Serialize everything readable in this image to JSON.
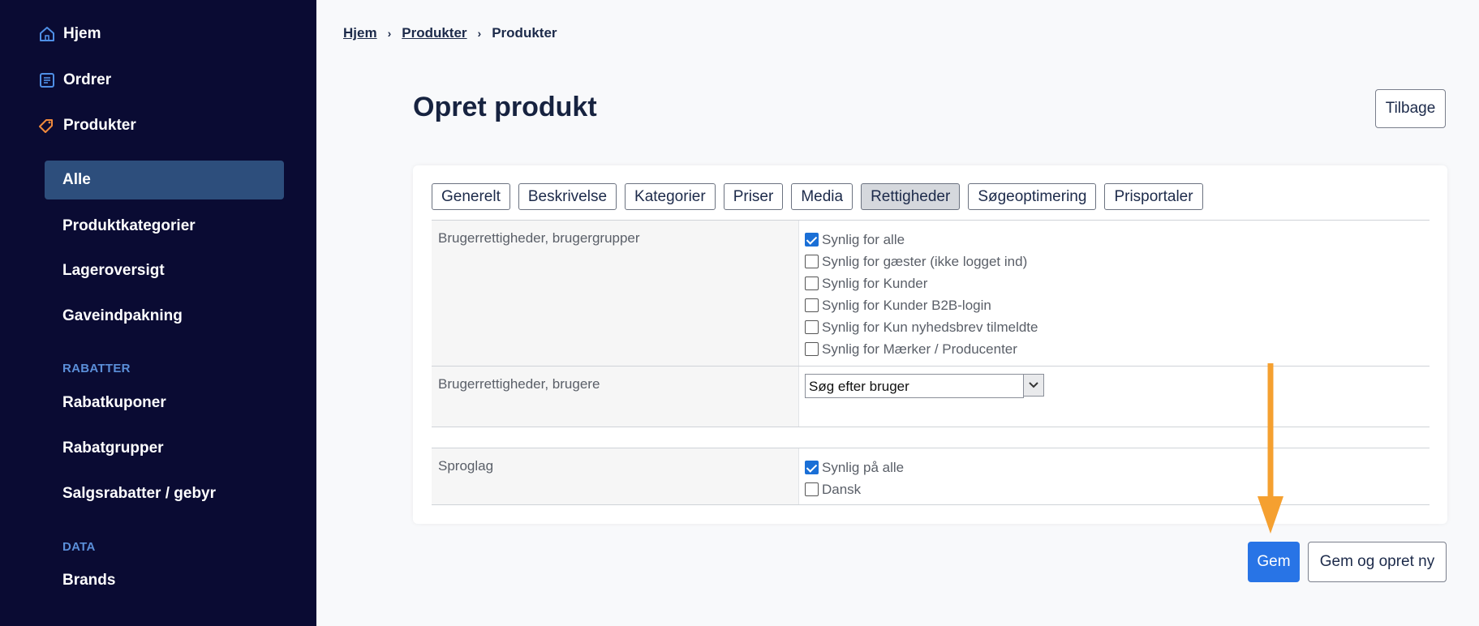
{
  "sidebar": {
    "top_items": [
      {
        "label": "Hjem",
        "icon": "home-icon"
      },
      {
        "label": "Ordrer",
        "icon": "orders-icon"
      },
      {
        "label": "Produkter",
        "icon": "tag-icon"
      }
    ],
    "sub_items": {
      "active": "Alle",
      "produktkategorier": "Produktkategorier",
      "lageroversigt": "Lageroversigt",
      "gaveindpakning": "Gaveindpakning"
    },
    "rabatter_section": "RABATTER",
    "rabatter_items": [
      "Rabatkuponer",
      "Rabatgrupper",
      "Salgsrabatter / gebyr"
    ],
    "data_section": "DATA",
    "data_items": [
      "Brands"
    ]
  },
  "breadcrumb": [
    "Hjem",
    "Produkter",
    "Produkter"
  ],
  "page": {
    "title": "Opret produkt",
    "back_label": "Tilbage"
  },
  "tabs": [
    {
      "label": "Generelt",
      "active": false
    },
    {
      "label": "Beskrivelse",
      "active": false
    },
    {
      "label": "Kategorier",
      "active": false
    },
    {
      "label": "Priser",
      "active": false
    },
    {
      "label": "Media",
      "active": false
    },
    {
      "label": "Rettigheder",
      "active": true
    },
    {
      "label": "Søgeoptimering",
      "active": false
    },
    {
      "label": "Prisportaler",
      "active": false
    }
  ],
  "permissions": {
    "groups": {
      "label": "Brugerrettigheder, brugergrupper",
      "options": [
        {
          "label": "Synlig for alle",
          "checked": true
        },
        {
          "label": "Synlig for gæster (ikke logget ind)",
          "checked": false
        },
        {
          "label": "Synlig for Kunder",
          "checked": false
        },
        {
          "label": "Synlig for Kunder B2B-login",
          "checked": false
        },
        {
          "label": "Synlig for Kun nyhedsbrev tilmeldte",
          "checked": false
        },
        {
          "label": "Synlig for Mærker / Producenter",
          "checked": false
        }
      ]
    },
    "users": {
      "label": "Brugerrettigheder, brugere",
      "search_value": "Søg efter bruger"
    },
    "languages": {
      "label": "Sproglag",
      "options": [
        {
          "label": "Synlig på alle",
          "checked": true
        },
        {
          "label": "Dansk",
          "checked": false
        }
      ]
    }
  },
  "actions": {
    "save_label": "Gem",
    "save_new_label": "Gem og opret ny"
  },
  "colors": {
    "sidebar_bg": "#0a0b33",
    "sidebar_active": "#2d4e7c",
    "accent": "#2874e6",
    "annotation_arrow": "#f5a030"
  }
}
